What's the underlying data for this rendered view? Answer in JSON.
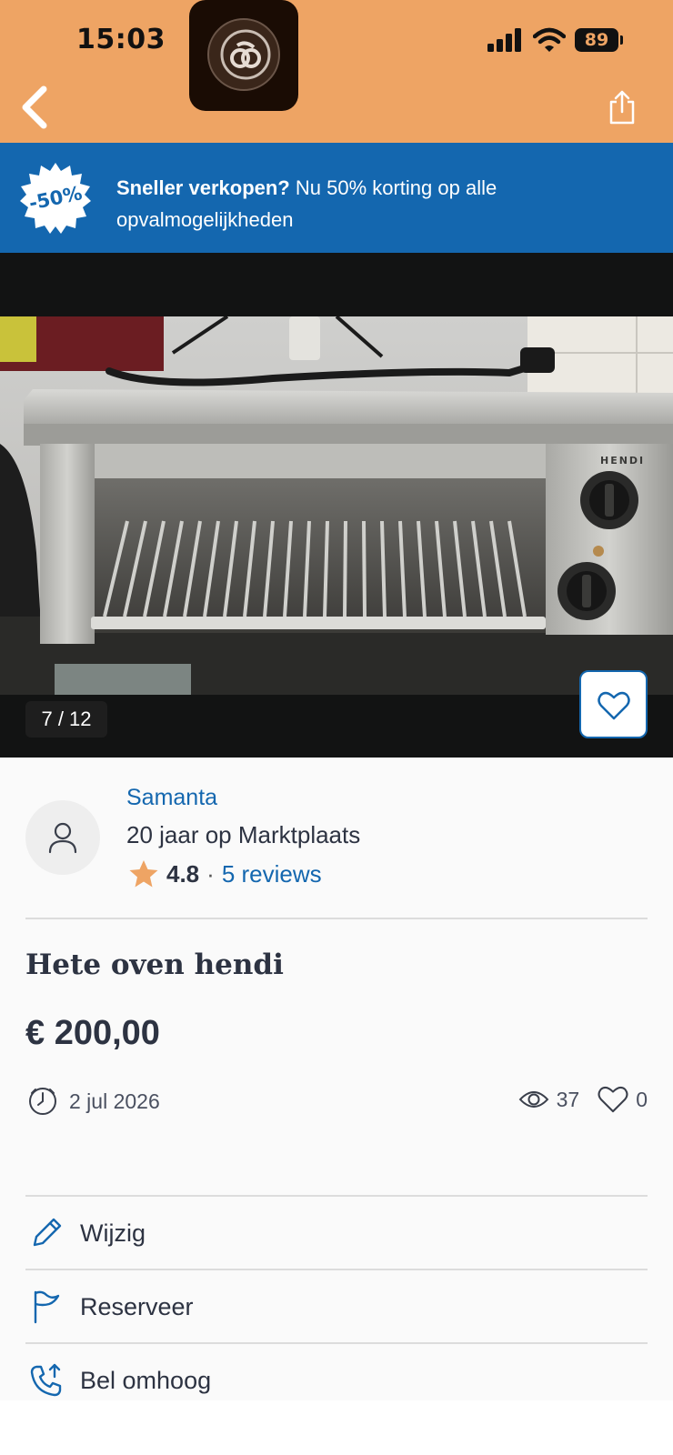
{
  "status_bar": {
    "time": "15:03",
    "battery": "89"
  },
  "header": {
    "back_icon": "chevron-left-icon",
    "share_icon": "share-icon",
    "bg_color": "#eea464"
  },
  "promo_banner": {
    "badge": "-50%",
    "bold_text": "Sneller verkopen?",
    "text": " Nu 50% korting op alle opvalmogelijkheden",
    "bg_color": "#1467af"
  },
  "gallery": {
    "counter": "7 / 12",
    "favorite_icon": "heart-icon",
    "brand_on_image": "HENDI"
  },
  "seller": {
    "name": "Samanta",
    "membership": "20 jaar op Marktplaats",
    "rating": "4.8",
    "separator": "·",
    "reviews": "5 reviews"
  },
  "listing": {
    "title": "Hete oven hendi",
    "price": "€ 200,00",
    "date": "2 jul 2026",
    "views": "37",
    "favorites": "0"
  },
  "actions": [
    {
      "label": "Wijzig",
      "icon": "pencil-icon"
    },
    {
      "label": "Reserveer",
      "icon": "flag-icon"
    },
    {
      "label": "Bel omhoog",
      "icon": "phone-up-icon"
    }
  ],
  "colors": {
    "accent_blue": "#1467af",
    "text_dark": "#2d3342",
    "star": "#eea464"
  }
}
